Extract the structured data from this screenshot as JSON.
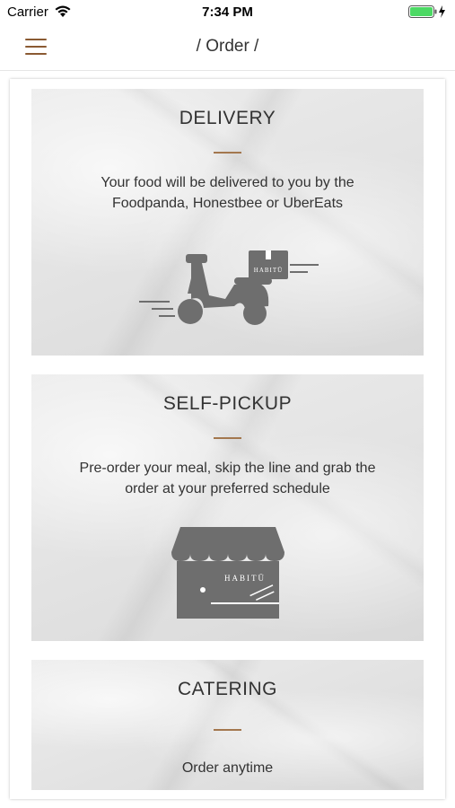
{
  "status_bar": {
    "carrier": "Carrier",
    "time": "7:34 PM"
  },
  "nav": {
    "title": "/ Order /"
  },
  "cards": [
    {
      "title": "DELIVERY",
      "desc_line1": "Your food will be delivered to you by the",
      "desc_line2": "Foodpanda, Honestbee or UberEats",
      "icon": "scooter-icon",
      "icon_label": "HABITŪ"
    },
    {
      "title": "SELF-PICKUP",
      "desc_line1": "Pre-order your meal, skip the line and grab the",
      "desc_line2": "order at your preferred schedule",
      "icon": "store-icon",
      "icon_label": "HABITŪ"
    },
    {
      "title": "CATERING",
      "desc_line1": "Order anytime",
      "desc_line2": ""
    }
  ],
  "colors": {
    "accent": "#8a5a32",
    "divider": "#a3774e",
    "icon_gray": "#6e6e6e",
    "card_bg": "#e6e6e6"
  }
}
